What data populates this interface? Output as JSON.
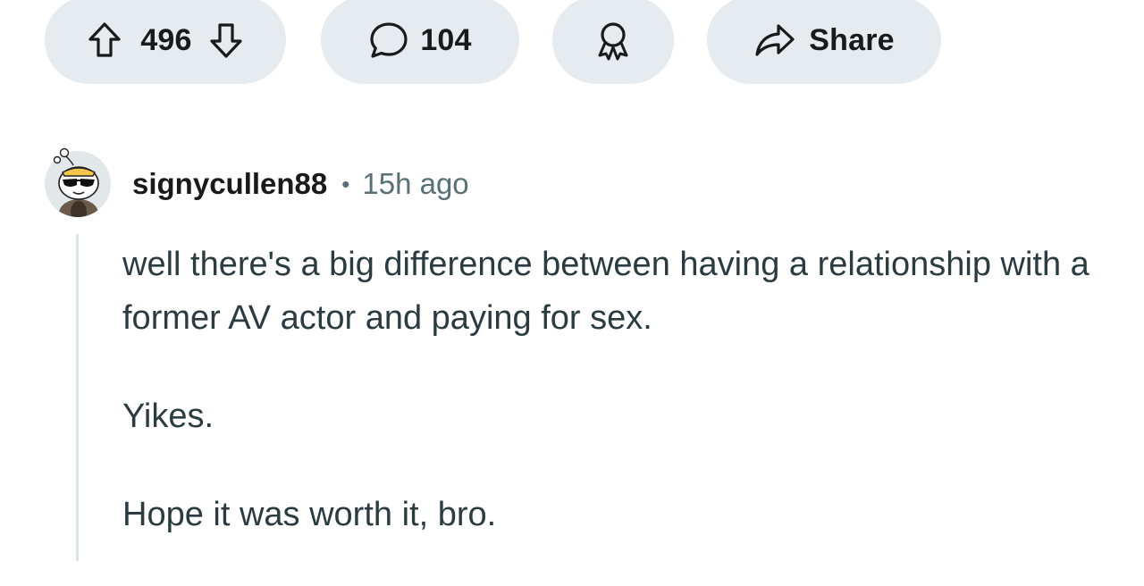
{
  "actions": {
    "vote_count": "496",
    "comment_count": "104",
    "share_label": "Share"
  },
  "comment": {
    "username": "signycullen88",
    "separator": "•",
    "timestamp": "15h ago",
    "paragraphs": [
      "well there's a big difference between having a relationship with a former AV actor and paying for sex.",
      "Yikes.",
      "Hope it was worth it, bro."
    ]
  },
  "colors": {
    "pill_background": "#e5ebee",
    "text_primary": "#1a1a1b",
    "text_body": "#2a3c42",
    "text_muted": "#576f76",
    "thread_line": "#e0e4e6"
  }
}
